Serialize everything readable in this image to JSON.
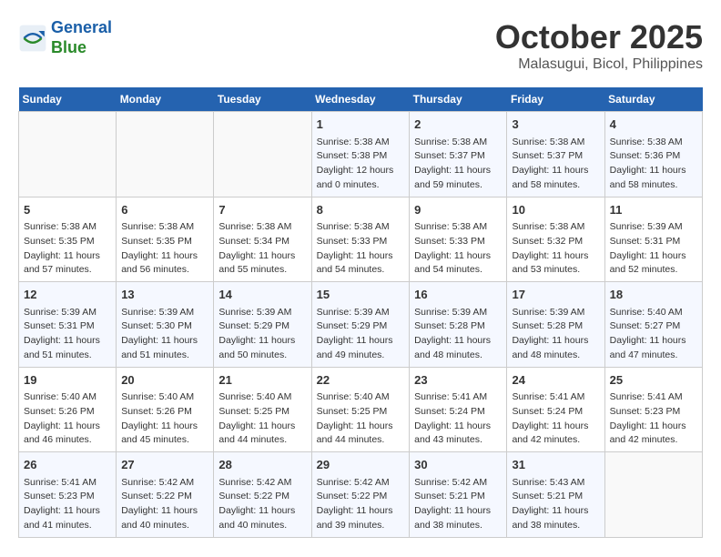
{
  "logo": {
    "line1": "General",
    "line2": "Blue"
  },
  "title": "October 2025",
  "subtitle": "Malasugui, Bicol, Philippines",
  "headers": [
    "Sunday",
    "Monday",
    "Tuesday",
    "Wednesday",
    "Thursday",
    "Friday",
    "Saturday"
  ],
  "weeks": [
    [
      {
        "day": "",
        "info": ""
      },
      {
        "day": "",
        "info": ""
      },
      {
        "day": "",
        "info": ""
      },
      {
        "day": "1",
        "info": "Sunrise: 5:38 AM\nSunset: 5:38 PM\nDaylight: 12 hours\nand 0 minutes."
      },
      {
        "day": "2",
        "info": "Sunrise: 5:38 AM\nSunset: 5:37 PM\nDaylight: 11 hours\nand 59 minutes."
      },
      {
        "day": "3",
        "info": "Sunrise: 5:38 AM\nSunset: 5:37 PM\nDaylight: 11 hours\nand 58 minutes."
      },
      {
        "day": "4",
        "info": "Sunrise: 5:38 AM\nSunset: 5:36 PM\nDaylight: 11 hours\nand 58 minutes."
      }
    ],
    [
      {
        "day": "5",
        "info": "Sunrise: 5:38 AM\nSunset: 5:35 PM\nDaylight: 11 hours\nand 57 minutes."
      },
      {
        "day": "6",
        "info": "Sunrise: 5:38 AM\nSunset: 5:35 PM\nDaylight: 11 hours\nand 56 minutes."
      },
      {
        "day": "7",
        "info": "Sunrise: 5:38 AM\nSunset: 5:34 PM\nDaylight: 11 hours\nand 55 minutes."
      },
      {
        "day": "8",
        "info": "Sunrise: 5:38 AM\nSunset: 5:33 PM\nDaylight: 11 hours\nand 54 minutes."
      },
      {
        "day": "9",
        "info": "Sunrise: 5:38 AM\nSunset: 5:33 PM\nDaylight: 11 hours\nand 54 minutes."
      },
      {
        "day": "10",
        "info": "Sunrise: 5:38 AM\nSunset: 5:32 PM\nDaylight: 11 hours\nand 53 minutes."
      },
      {
        "day": "11",
        "info": "Sunrise: 5:39 AM\nSunset: 5:31 PM\nDaylight: 11 hours\nand 52 minutes."
      }
    ],
    [
      {
        "day": "12",
        "info": "Sunrise: 5:39 AM\nSunset: 5:31 PM\nDaylight: 11 hours\nand 51 minutes."
      },
      {
        "day": "13",
        "info": "Sunrise: 5:39 AM\nSunset: 5:30 PM\nDaylight: 11 hours\nand 51 minutes."
      },
      {
        "day": "14",
        "info": "Sunrise: 5:39 AM\nSunset: 5:29 PM\nDaylight: 11 hours\nand 50 minutes."
      },
      {
        "day": "15",
        "info": "Sunrise: 5:39 AM\nSunset: 5:29 PM\nDaylight: 11 hours\nand 49 minutes."
      },
      {
        "day": "16",
        "info": "Sunrise: 5:39 AM\nSunset: 5:28 PM\nDaylight: 11 hours\nand 48 minutes."
      },
      {
        "day": "17",
        "info": "Sunrise: 5:39 AM\nSunset: 5:28 PM\nDaylight: 11 hours\nand 48 minutes."
      },
      {
        "day": "18",
        "info": "Sunrise: 5:40 AM\nSunset: 5:27 PM\nDaylight: 11 hours\nand 47 minutes."
      }
    ],
    [
      {
        "day": "19",
        "info": "Sunrise: 5:40 AM\nSunset: 5:26 PM\nDaylight: 11 hours\nand 46 minutes."
      },
      {
        "day": "20",
        "info": "Sunrise: 5:40 AM\nSunset: 5:26 PM\nDaylight: 11 hours\nand 45 minutes."
      },
      {
        "day": "21",
        "info": "Sunrise: 5:40 AM\nSunset: 5:25 PM\nDaylight: 11 hours\nand 44 minutes."
      },
      {
        "day": "22",
        "info": "Sunrise: 5:40 AM\nSunset: 5:25 PM\nDaylight: 11 hours\nand 44 minutes."
      },
      {
        "day": "23",
        "info": "Sunrise: 5:41 AM\nSunset: 5:24 PM\nDaylight: 11 hours\nand 43 minutes."
      },
      {
        "day": "24",
        "info": "Sunrise: 5:41 AM\nSunset: 5:24 PM\nDaylight: 11 hours\nand 42 minutes."
      },
      {
        "day": "25",
        "info": "Sunrise: 5:41 AM\nSunset: 5:23 PM\nDaylight: 11 hours\nand 42 minutes."
      }
    ],
    [
      {
        "day": "26",
        "info": "Sunrise: 5:41 AM\nSunset: 5:23 PM\nDaylight: 11 hours\nand 41 minutes."
      },
      {
        "day": "27",
        "info": "Sunrise: 5:42 AM\nSunset: 5:22 PM\nDaylight: 11 hours\nand 40 minutes."
      },
      {
        "day": "28",
        "info": "Sunrise: 5:42 AM\nSunset: 5:22 PM\nDaylight: 11 hours\nand 40 minutes."
      },
      {
        "day": "29",
        "info": "Sunrise: 5:42 AM\nSunset: 5:22 PM\nDaylight: 11 hours\nand 39 minutes."
      },
      {
        "day": "30",
        "info": "Sunrise: 5:42 AM\nSunset: 5:21 PM\nDaylight: 11 hours\nand 38 minutes."
      },
      {
        "day": "31",
        "info": "Sunrise: 5:43 AM\nSunset: 5:21 PM\nDaylight: 11 hours\nand 38 minutes."
      },
      {
        "day": "",
        "info": ""
      }
    ]
  ]
}
